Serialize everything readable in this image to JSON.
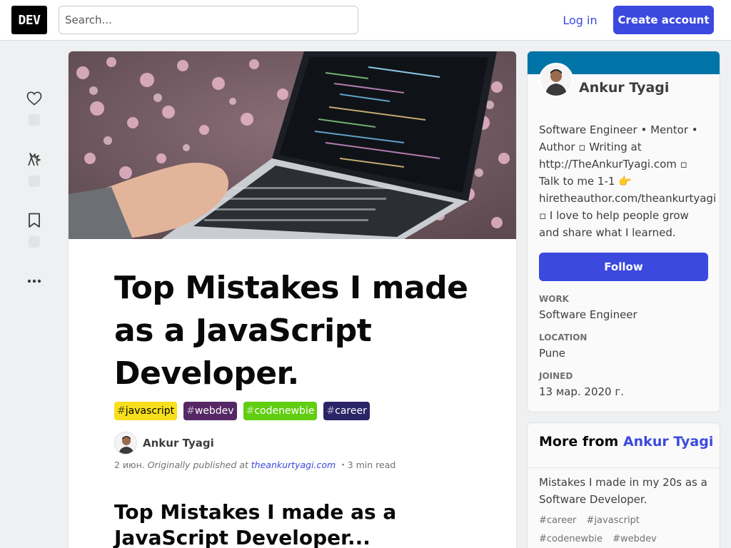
{
  "header": {
    "logo": "DEV",
    "search_placeholder": "Search...",
    "login": "Log in",
    "create_account": "Create account"
  },
  "reactions": {
    "like_icon": "heart-icon",
    "unicorn_icon": "unicorn-icon",
    "save_icon": "bookmark-icon",
    "more_icon": "ellipsis-icon"
  },
  "article": {
    "title": "Top Mistakes I made as a JavaScript Developer.",
    "tags": [
      {
        "hash": "#",
        "name": "javascript",
        "bg": "#f7df1e",
        "fg": "#000000"
      },
      {
        "hash": "#",
        "name": "webdev",
        "bg": "#562765",
        "fg": "#ffffff"
      },
      {
        "hash": "#",
        "name": "codenewbie",
        "bg": "#61ce12",
        "fg": "#ffffff"
      },
      {
        "hash": "#",
        "name": "career",
        "bg": "#2a2566",
        "fg": "#ffffff"
      }
    ],
    "author": "Ankur Tyagi",
    "date": "2 июн.",
    "originally": "Originally published at",
    "origin_link": "theankurtyagi.com",
    "read_time": "・3 min read",
    "heading": "Top Mistakes I made as a JavaScript Developer..."
  },
  "profile": {
    "name": "Ankur Tyagi",
    "bio": "Software Engineer • Mentor • Author ▫ Writing at http://TheAnkurTyagi.com ▫ Talk to me 1-1 👉 hiretheauthor.com/theankurtyagi ▫ I love to help people grow and share what I learned.",
    "follow": "Follow",
    "work_label": "WORK",
    "work": "Software Engineer",
    "location_label": "LOCATION",
    "location": "Pune",
    "joined_label": "JOINED",
    "joined": "13 мар. 2020 г."
  },
  "more_from": {
    "prefix": "More from",
    "author": "Ankur Tyagi",
    "item_title": "Mistakes I made in my 20s as a Software Developer.",
    "item_tags": [
      "#career",
      "#javascript",
      "#codenewbie",
      "#webdev"
    ]
  },
  "colors": {
    "accent": "#3b49df",
    "profile_banner": "#0074a7"
  }
}
